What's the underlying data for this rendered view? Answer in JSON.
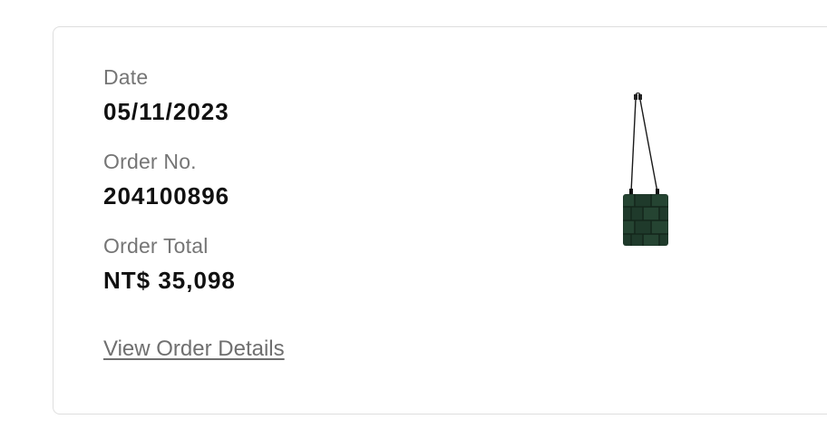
{
  "order": {
    "date_label": "Date",
    "date_value": "05/11/2023",
    "order_no_label": "Order No.",
    "order_no_value": "204100896",
    "total_label": "Order Total",
    "total_value": "NT$ 35,098",
    "details_link": "View Order Details"
  },
  "product": {
    "image_icon": "crossbody-bag-icon",
    "color": "#1f3a2b"
  },
  "colors": {
    "label": "#757575",
    "value": "#111111",
    "link": "#6f6f6f",
    "border": "#dedede"
  }
}
